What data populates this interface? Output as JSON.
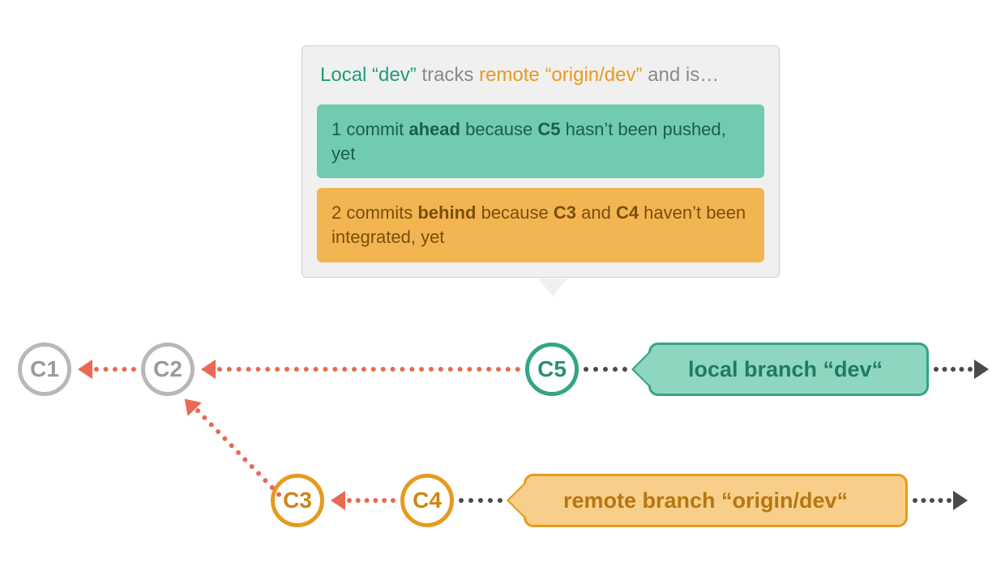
{
  "callout": {
    "title_local": "Local “dev”",
    "title_tracks": " tracks ",
    "title_remote": "remote “origin/dev”",
    "title_tail": " and is…",
    "ahead_prefix": "1 commit ",
    "ahead_word": "ahead",
    "ahead_mid": " because ",
    "ahead_commit": "C5",
    "ahead_suffix": " hasn’t been pushed, yet",
    "behind_prefix": "2 commits ",
    "behind_word": "behind",
    "behind_mid1": " because ",
    "behind_c3": "C3",
    "behind_and": " and ",
    "behind_c4": "C4",
    "behind_suffix": " haven’t been integrated, yet"
  },
  "nodes": {
    "c1": "C1",
    "c2": "C2",
    "c3": "C3",
    "c4": "C4",
    "c5": "C5"
  },
  "branches": {
    "local_label": "local branch “dev“",
    "remote_label": "remote branch “origin/dev“"
  },
  "colors": {
    "green": "#32a586",
    "green_fill": "#8fd6c1",
    "orange": "#e79a1f",
    "orange_fill": "#f7cf8a",
    "gray": "#b8b8b8",
    "red": "#e86a52",
    "black": "#4a4a4a",
    "box_bg": "#f0f0f0"
  }
}
